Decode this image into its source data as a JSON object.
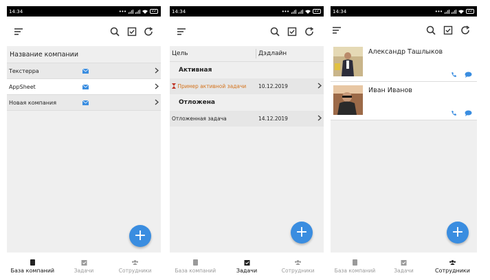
{
  "status": {
    "time": "14:34",
    "battery": "22"
  },
  "nav": {
    "companies": "База компаний",
    "tasks": "Задачи",
    "employees": "Сотрудники"
  },
  "screen1": {
    "header": "Название компании",
    "companies": [
      {
        "name": "Текстерра"
      },
      {
        "name": "AppSheet"
      },
      {
        "name": "Новая компания"
      }
    ]
  },
  "screen2": {
    "col_goal": "Цель",
    "col_deadline": "Дэдлайн",
    "groups": [
      {
        "title": "Активная",
        "task": "Пример активной задачи",
        "date": "10.12.2019"
      },
      {
        "title": "Отложена",
        "task": "Отложенная задача",
        "date": "14.12.2019"
      }
    ]
  },
  "screen3": {
    "employees": [
      {
        "name": "Александр Ташлыков"
      },
      {
        "name": "Иван Иванов"
      }
    ]
  },
  "colors": {
    "accent": "#3a8de0",
    "active_task": "#d4731c",
    "hourglass": "#c0392b"
  },
  "fab_label": "+"
}
